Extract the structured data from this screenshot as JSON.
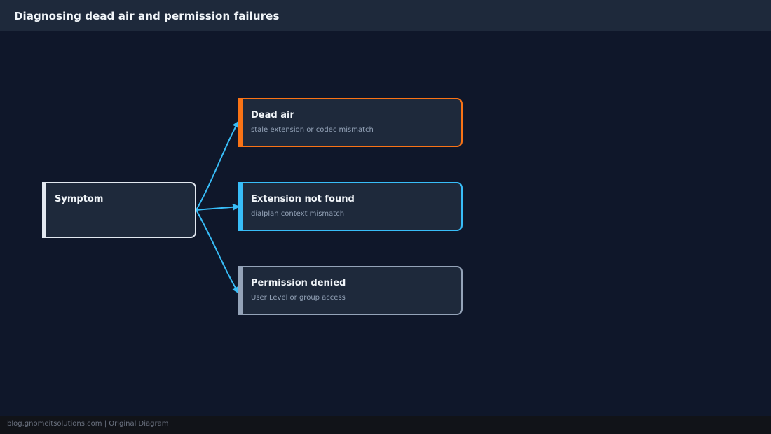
{
  "header": {
    "title": "Diagnosing dead air and permission failures"
  },
  "diagram": {
    "root": {
      "title": "Symptom",
      "color": "#e2e8f0"
    },
    "branches": [
      {
        "title": "Dead air",
        "subtitle": "stale extension or codec mismatch",
        "color": "#f97316"
      },
      {
        "title": "Extension not found",
        "subtitle": "dialplan context mismatch",
        "color": "#38bdf8"
      },
      {
        "title": "Permission denied",
        "subtitle": "User Level or group access",
        "color": "#94a3b8"
      }
    ],
    "connector_color": "#38bdf8"
  },
  "footer": {
    "text": "blog.gnomeitsolutions.com | Original Diagram"
  }
}
